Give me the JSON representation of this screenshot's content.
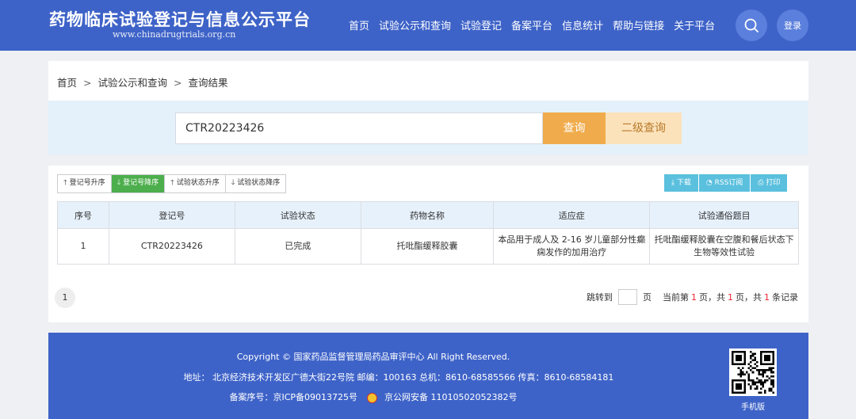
{
  "header": {
    "title": "药物临床试验登记与信息公示平台",
    "subtitle": "www.chinadrugtrials.org.cn",
    "nav": [
      "首页",
      "试验公示和查询",
      "试验登记",
      "备案平台",
      "信息统计",
      "帮助与链接",
      "关于平台"
    ],
    "search_icon": "search-icon",
    "login_label": "登录"
  },
  "breadcrumb": {
    "items": [
      "首页",
      "试验公示和查询",
      "查询结果"
    ],
    "separator": ">"
  },
  "search": {
    "value": "CTR20223426",
    "query_label": "查询",
    "second_label": "二级查询"
  },
  "sort_buttons": [
    {
      "icon": "arrow-up-icon",
      "label": "登记号升序"
    },
    {
      "icon": "arrow-down-icon",
      "label": "登记号降序"
    },
    {
      "icon": "arrow-up-icon",
      "label": "试验状态升序"
    },
    {
      "icon": "arrow-down-icon",
      "label": "试验状态降序"
    }
  ],
  "tool_buttons": [
    {
      "icon": "download-icon",
      "label": "下载"
    },
    {
      "icon": "rss-icon",
      "label": "RSS订阅"
    },
    {
      "icon": "print-icon",
      "label": "打印"
    }
  ],
  "colors": {
    "primary": "#3e63c8",
    "active_sort": "#4cae4c",
    "tool_button": "#5bc0de",
    "query_button": "#f0ac4c",
    "second_button": "#fbe2bb"
  },
  "table": {
    "headers": [
      "序号",
      "登记号",
      "试验状态",
      "药物名称",
      "适应症",
      "试验通俗题目"
    ],
    "rows": [
      [
        "1",
        "CTR20223426",
        "已完成",
        "托吡酯缓释胶囊",
        "本品用于成人及 2-16 岁儿童部分性癫痫发作的加用治疗",
        "托吡酯缓释胶囊在空腹和餐后状态下生物等效性试验"
      ]
    ]
  },
  "pagination": {
    "current_page": "1",
    "jump_label": "跳转到",
    "page_unit": "页",
    "info_prefix": "当前第",
    "current": "1",
    "info_mid1": "页，共",
    "total_pages": "1",
    "info_mid2": "页，共",
    "total_records": "1",
    "info_suffix": "条记录"
  },
  "footer": {
    "copyright": "Copyright © 国家药品监督管理局药品审评中心 All Right Reserved.",
    "address": "地址：  北京经济技术开发区广德大街22号院  邮编：100163  总机：8610-68585566  传真：8610-68584181",
    "icp": "备案序号：京ICP备09013725号",
    "police": "京公网安备 11010502052382号",
    "mobile_label": "手机版"
  }
}
